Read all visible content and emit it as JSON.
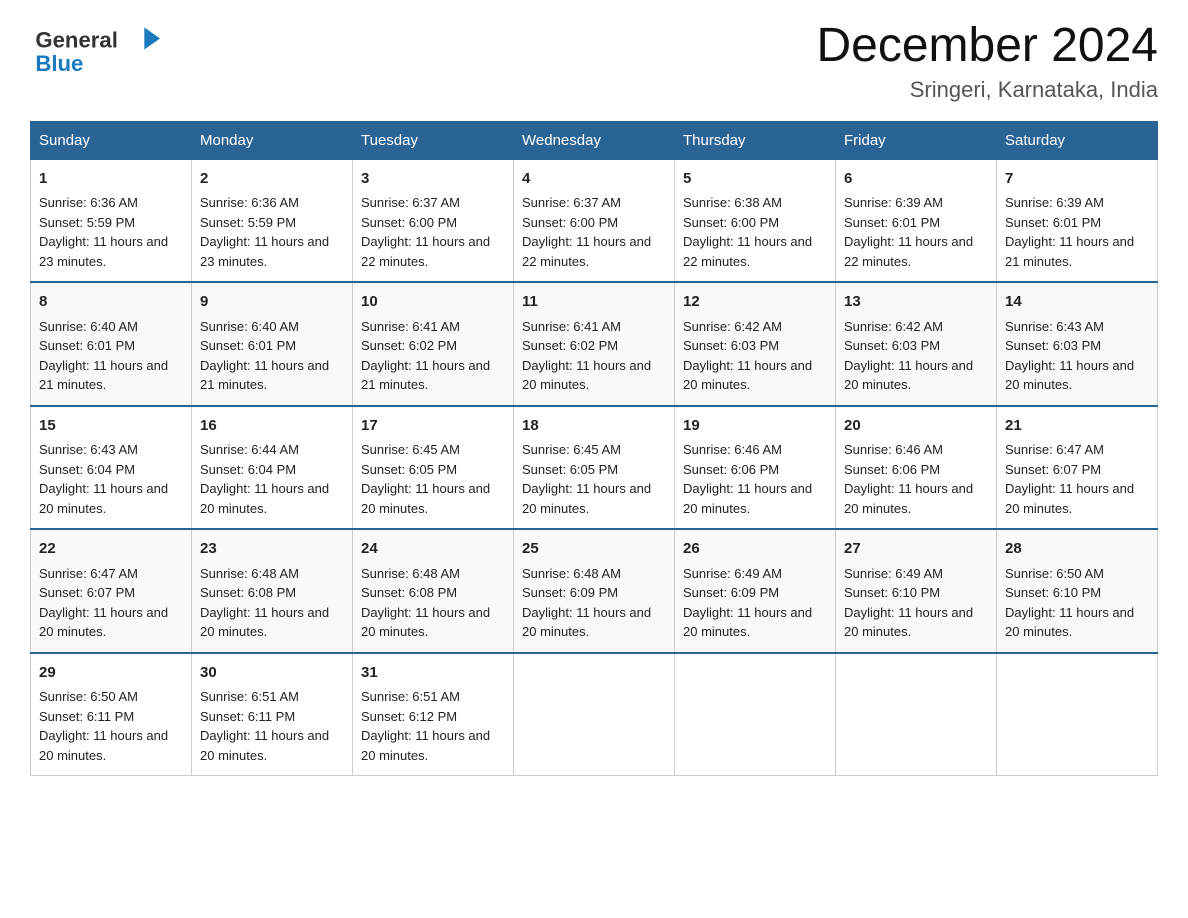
{
  "header": {
    "logo_text_general": "General",
    "logo_text_blue": "Blue",
    "month_title": "December 2024",
    "location": "Sringeri, Karnataka, India"
  },
  "days": [
    "Sunday",
    "Monday",
    "Tuesday",
    "Wednesday",
    "Thursday",
    "Friday",
    "Saturday"
  ],
  "weeks": [
    [
      {
        "date": "1",
        "sunrise": "6:36 AM",
        "sunset": "5:59 PM",
        "daylight": "11 hours and 23 minutes."
      },
      {
        "date": "2",
        "sunrise": "6:36 AM",
        "sunset": "5:59 PM",
        "daylight": "11 hours and 23 minutes."
      },
      {
        "date": "3",
        "sunrise": "6:37 AM",
        "sunset": "6:00 PM",
        "daylight": "11 hours and 22 minutes."
      },
      {
        "date": "4",
        "sunrise": "6:37 AM",
        "sunset": "6:00 PM",
        "daylight": "11 hours and 22 minutes."
      },
      {
        "date": "5",
        "sunrise": "6:38 AM",
        "sunset": "6:00 PM",
        "daylight": "11 hours and 22 minutes."
      },
      {
        "date": "6",
        "sunrise": "6:39 AM",
        "sunset": "6:01 PM",
        "daylight": "11 hours and 22 minutes."
      },
      {
        "date": "7",
        "sunrise": "6:39 AM",
        "sunset": "6:01 PM",
        "daylight": "11 hours and 21 minutes."
      }
    ],
    [
      {
        "date": "8",
        "sunrise": "6:40 AM",
        "sunset": "6:01 PM",
        "daylight": "11 hours and 21 minutes."
      },
      {
        "date": "9",
        "sunrise": "6:40 AM",
        "sunset": "6:01 PM",
        "daylight": "11 hours and 21 minutes."
      },
      {
        "date": "10",
        "sunrise": "6:41 AM",
        "sunset": "6:02 PM",
        "daylight": "11 hours and 21 minutes."
      },
      {
        "date": "11",
        "sunrise": "6:41 AM",
        "sunset": "6:02 PM",
        "daylight": "11 hours and 20 minutes."
      },
      {
        "date": "12",
        "sunrise": "6:42 AM",
        "sunset": "6:03 PM",
        "daylight": "11 hours and 20 minutes."
      },
      {
        "date": "13",
        "sunrise": "6:42 AM",
        "sunset": "6:03 PM",
        "daylight": "11 hours and 20 minutes."
      },
      {
        "date": "14",
        "sunrise": "6:43 AM",
        "sunset": "6:03 PM",
        "daylight": "11 hours and 20 minutes."
      }
    ],
    [
      {
        "date": "15",
        "sunrise": "6:43 AM",
        "sunset": "6:04 PM",
        "daylight": "11 hours and 20 minutes."
      },
      {
        "date": "16",
        "sunrise": "6:44 AM",
        "sunset": "6:04 PM",
        "daylight": "11 hours and 20 minutes."
      },
      {
        "date": "17",
        "sunrise": "6:45 AM",
        "sunset": "6:05 PM",
        "daylight": "11 hours and 20 minutes."
      },
      {
        "date": "18",
        "sunrise": "6:45 AM",
        "sunset": "6:05 PM",
        "daylight": "11 hours and 20 minutes."
      },
      {
        "date": "19",
        "sunrise": "6:46 AM",
        "sunset": "6:06 PM",
        "daylight": "11 hours and 20 minutes."
      },
      {
        "date": "20",
        "sunrise": "6:46 AM",
        "sunset": "6:06 PM",
        "daylight": "11 hours and 20 minutes."
      },
      {
        "date": "21",
        "sunrise": "6:47 AM",
        "sunset": "6:07 PM",
        "daylight": "11 hours and 20 minutes."
      }
    ],
    [
      {
        "date": "22",
        "sunrise": "6:47 AM",
        "sunset": "6:07 PM",
        "daylight": "11 hours and 20 minutes."
      },
      {
        "date": "23",
        "sunrise": "6:48 AM",
        "sunset": "6:08 PM",
        "daylight": "11 hours and 20 minutes."
      },
      {
        "date": "24",
        "sunrise": "6:48 AM",
        "sunset": "6:08 PM",
        "daylight": "11 hours and 20 minutes."
      },
      {
        "date": "25",
        "sunrise": "6:48 AM",
        "sunset": "6:09 PM",
        "daylight": "11 hours and 20 minutes."
      },
      {
        "date": "26",
        "sunrise": "6:49 AM",
        "sunset": "6:09 PM",
        "daylight": "11 hours and 20 minutes."
      },
      {
        "date": "27",
        "sunrise": "6:49 AM",
        "sunset": "6:10 PM",
        "daylight": "11 hours and 20 minutes."
      },
      {
        "date": "28",
        "sunrise": "6:50 AM",
        "sunset": "6:10 PM",
        "daylight": "11 hours and 20 minutes."
      }
    ],
    [
      {
        "date": "29",
        "sunrise": "6:50 AM",
        "sunset": "6:11 PM",
        "daylight": "11 hours and 20 minutes."
      },
      {
        "date": "30",
        "sunrise": "6:51 AM",
        "sunset": "6:11 PM",
        "daylight": "11 hours and 20 minutes."
      },
      {
        "date": "31",
        "sunrise": "6:51 AM",
        "sunset": "6:12 PM",
        "daylight": "11 hours and 20 minutes."
      },
      null,
      null,
      null,
      null
    ]
  ],
  "labels": {
    "sunrise": "Sunrise:",
    "sunset": "Sunset:",
    "daylight": "Daylight:"
  }
}
